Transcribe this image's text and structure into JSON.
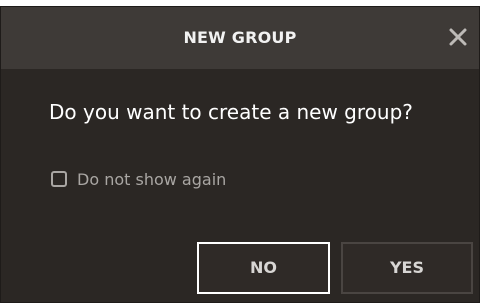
{
  "dialog": {
    "title": "NEW GROUP",
    "close_icon": "close-icon",
    "question": "Do you want to create a new group?",
    "checkbox": {
      "label": "Do not show again",
      "checked": false
    },
    "buttons": {
      "no_label": "NO",
      "yes_label": "YES"
    }
  },
  "colors": {
    "body_bg": "#2b2724",
    "titlebar_bg": "#3e3a37",
    "text_primary": "#ffffff",
    "text_muted": "#a9a6a3",
    "focus_border": "#ffffff",
    "button_border": "#4a4542"
  }
}
